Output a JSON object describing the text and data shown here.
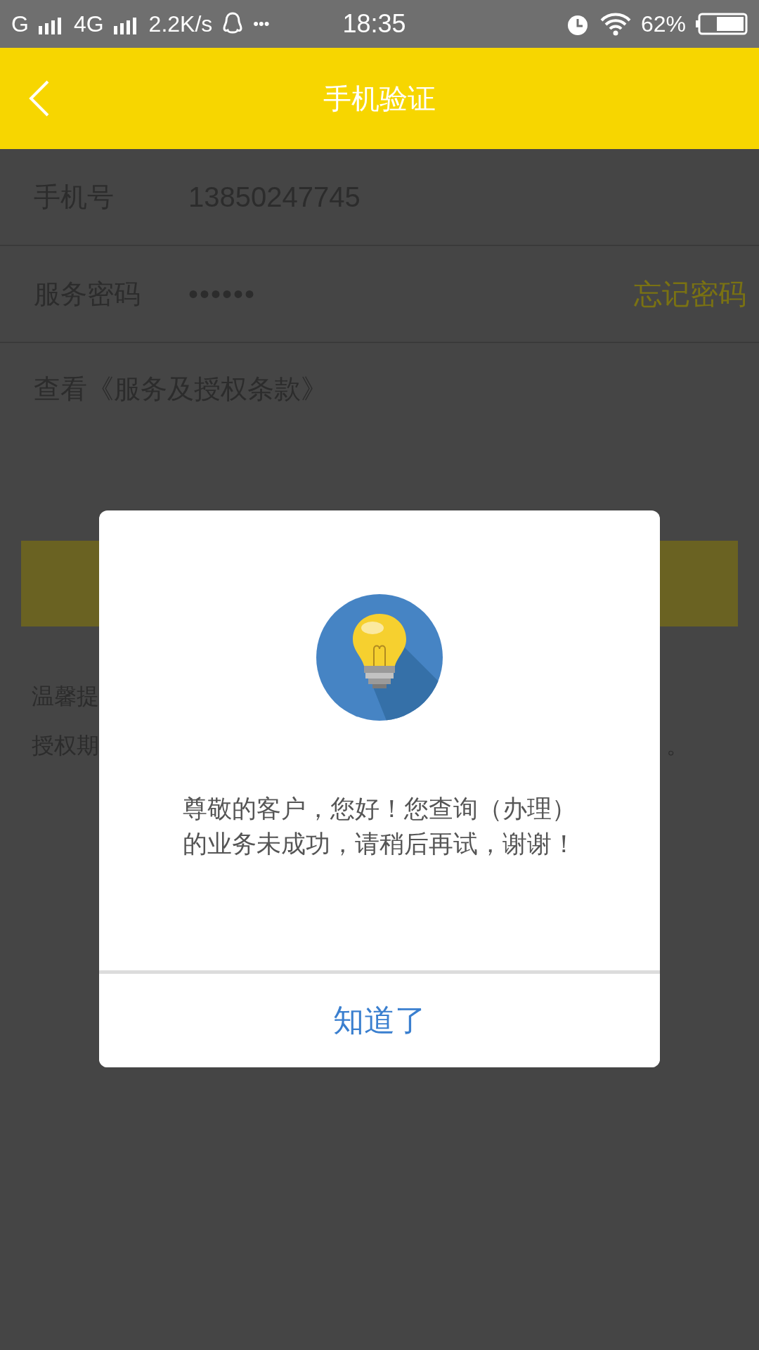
{
  "status_bar": {
    "carrier_1": "G",
    "carrier_2": "4G",
    "speed": "2.2K/s",
    "more": "•••",
    "time": "18:35",
    "battery": "62%"
  },
  "header": {
    "title": "手机验证"
  },
  "form": {
    "rows": [
      {
        "kind": "text",
        "label": "手机号",
        "value": "13850247745"
      },
      {
        "kind": "password",
        "label": "服务密码",
        "value": "••••••",
        "action": "忘记密码"
      }
    ],
    "terms_link": "查看《服务及授权条款》"
  },
  "notice": {
    "line_1": "温馨提",
    "line_2": "授权期",
    "line_2_end": "。"
  },
  "dialog": {
    "message": "尊敬的客户，您好！您查询（办理）的业务未成功，请稍后再试，谢谢！",
    "button": "知道了"
  }
}
